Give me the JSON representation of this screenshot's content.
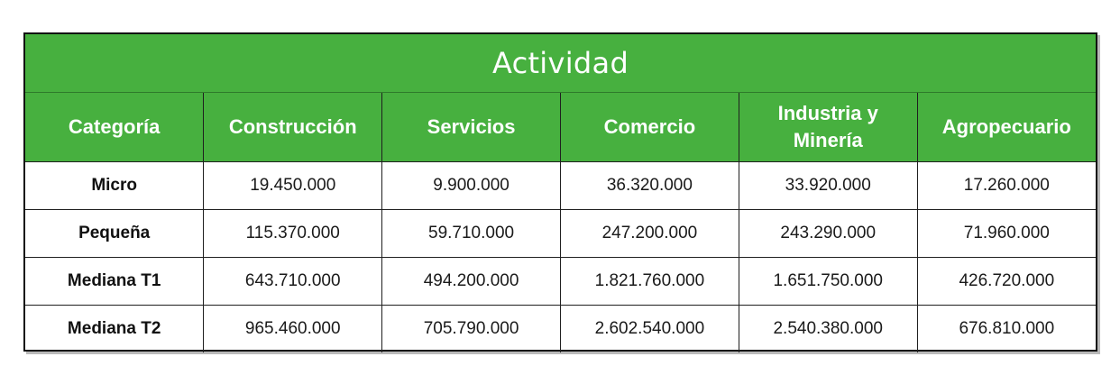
{
  "table": {
    "title": "Actividad",
    "headers": [
      "Categoría",
      "Construcción",
      "Servicios",
      "Comercio",
      "Industria y Minería",
      "Agropecuario"
    ],
    "rows": [
      {
        "label": "Micro",
        "values": [
          "19.450.000",
          "9.900.000",
          "36.320.000",
          "33.920.000",
          "17.260.000"
        ]
      },
      {
        "label": "Pequeña",
        "values": [
          "115.370.000",
          "59.710.000",
          "247.200.000",
          "243.290.000",
          "71.960.000"
        ]
      },
      {
        "label": "Mediana T1",
        "values": [
          "643.710.000",
          "494.200.000",
          "1.821.760.000",
          "1.651.750.000",
          "426.720.000"
        ]
      },
      {
        "label": "Mediana T2",
        "values": [
          "965.460.000",
          "705.790.000",
          "2.602.540.000",
          "2.540.380.000",
          "676.810.000"
        ]
      }
    ]
  },
  "colors": {
    "header_green": "#47b03f",
    "header_text": "#ffffff",
    "border": "#1f1f1f"
  }
}
